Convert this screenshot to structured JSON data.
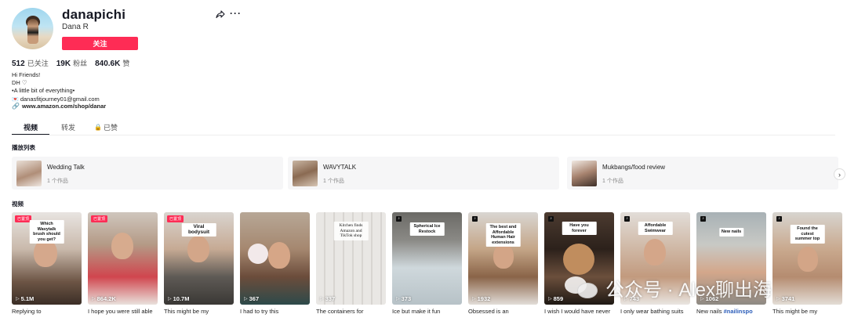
{
  "profile": {
    "username": "danapichi",
    "nickname": "Dana R",
    "follow_label": "关注",
    "stats": [
      {
        "value": "512",
        "label": "已关注"
      },
      {
        "value": "19K",
        "label": "粉丝"
      },
      {
        "value": "840.6K",
        "label": "赞"
      }
    ],
    "bio_lines": [
      "Hi Friends!",
      "DH ♡",
      "•A little bit of everything•"
    ],
    "bio_email": "danasfitjourney01@gmail.com",
    "bio_link": "www.amazon.com/shop/danar"
  },
  "tabs": [
    {
      "label": "视频"
    },
    {
      "label": "转发"
    },
    {
      "label": "已赞"
    }
  ],
  "playlists": {
    "label": "播放列表",
    "items": [
      {
        "title": "Wedding Talk",
        "count": "1 个作品"
      },
      {
        "title": "WAVYTALK",
        "count": "1 个作品"
      },
      {
        "title": "Mukbangs/food review",
        "count": "1 个作品"
      }
    ]
  },
  "videos": {
    "label": "视频",
    "pinned_label": "已置顶",
    "items": [
      {
        "plays": "5.1M",
        "caption": "Which Wavytalk brush should you get?",
        "desc": "Replying to",
        "pinned": true
      },
      {
        "plays": "864.2K",
        "caption": "",
        "desc": "I hope you were still able",
        "pinned": true
      },
      {
        "plays": "10.7M",
        "caption": "Viral bodysuit",
        "desc": "This might be my",
        "pinned": true
      },
      {
        "plays": "367",
        "caption": "",
        "desc": "I had to try this",
        "pinned": false
      },
      {
        "plays": "337",
        "caption": "Kitchen finds Amazon and TikTok shop",
        "desc": "The containers for",
        "pinned": false
      },
      {
        "plays": "373",
        "caption": "Spherical Ice Restock",
        "desc": "Ice but make it fun",
        "pinned": false
      },
      {
        "plays": "1932",
        "caption": "The best and Affordable Human Hair extensions",
        "desc": "Obsessed is an",
        "pinned": false
      },
      {
        "plays": "859",
        "caption": "Have you forever",
        "desc": "I wish I would have never",
        "pinned": false
      },
      {
        "plays": "743",
        "caption": "Affordable Swimwear",
        "desc": "I only wear bathing suits",
        "pinned": false
      },
      {
        "plays": "1062",
        "caption": "New nails",
        "desc": "New nails",
        "desc_tag": "#nailinspo",
        "pinned": false
      },
      {
        "plays": "3741",
        "caption": "Found the cutest summer top",
        "desc": "This might be my",
        "pinned": false
      }
    ]
  },
  "watermark": {
    "text": "公众号 · Alex聊出海"
  },
  "colors": {
    "accent": "#fe2c55",
    "tag": "#2b5db9",
    "card_bg": "#f6f6f7"
  }
}
